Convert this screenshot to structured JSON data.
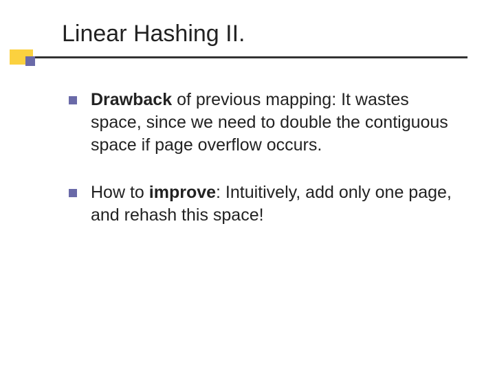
{
  "title": "Linear Hashing II.",
  "bullets": [
    {
      "bold_prefix": "Drawback",
      "rest": " of previous mapping: It wastes space, since we need to double the contiguous space if page overflow occurs."
    },
    {
      "plain_prefix": "How to ",
      "bold_mid": "improve",
      "rest": ": Intuitively, add only one page, and rehash this space!"
    }
  ]
}
